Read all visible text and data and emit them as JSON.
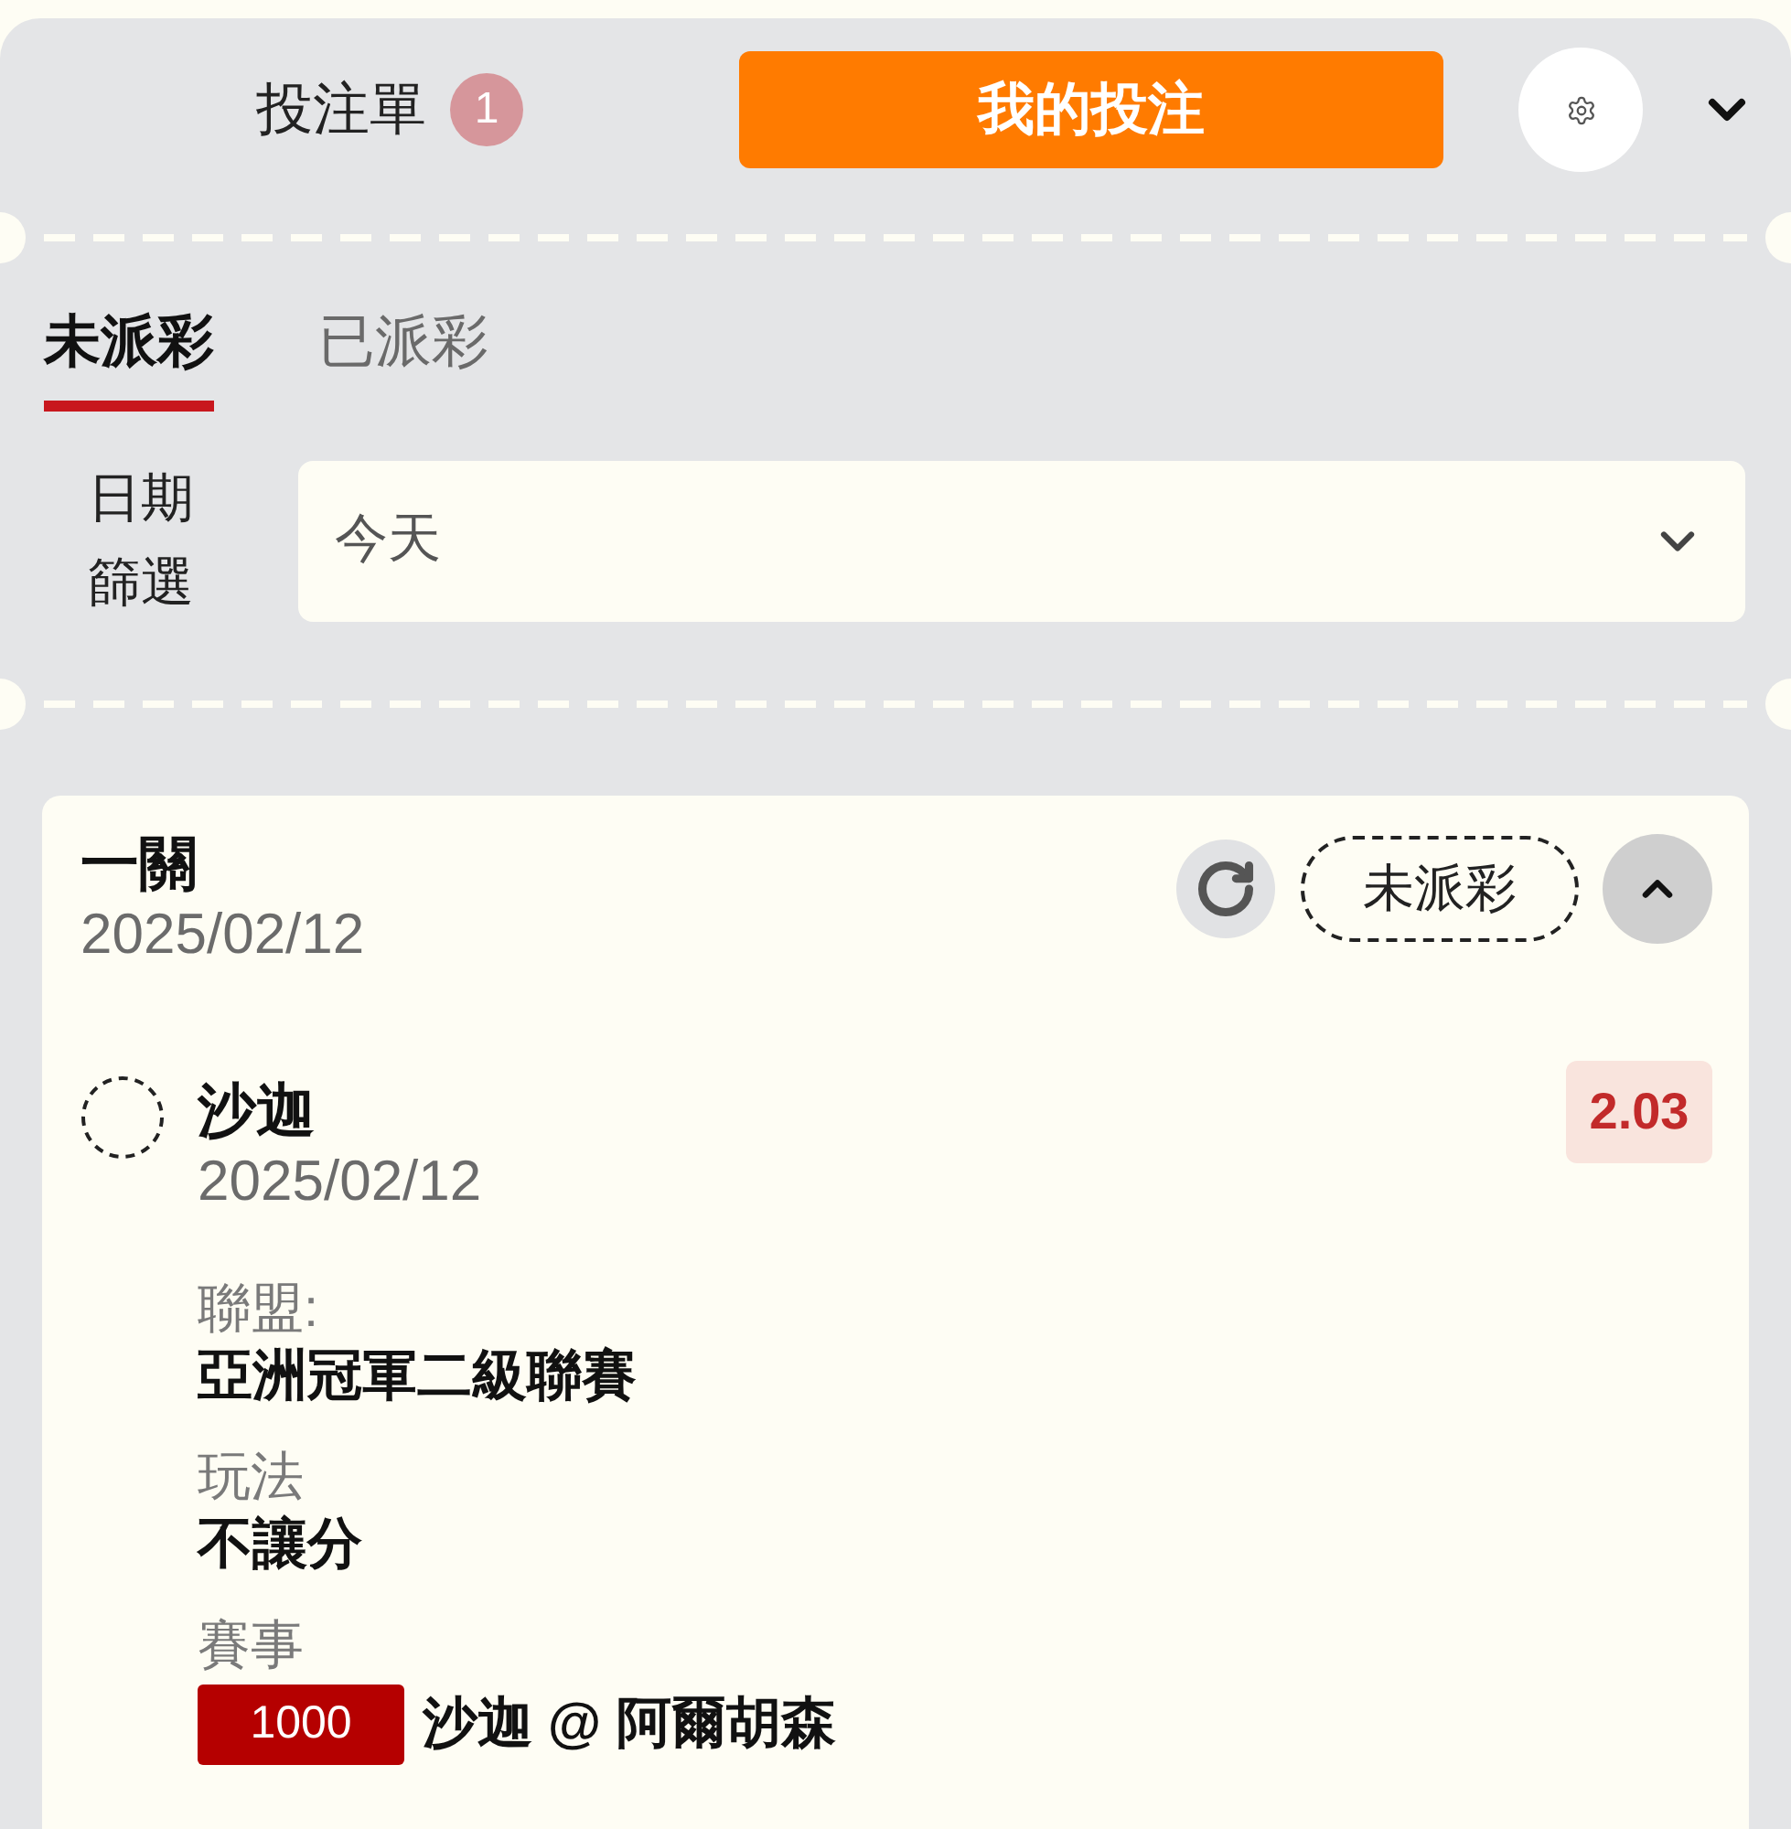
{
  "header": {
    "title": "投注單",
    "count": "1",
    "my_bets_button": "我的投注"
  },
  "tabs": [
    {
      "label": "未派彩",
      "selected": true
    },
    {
      "label": "已派彩",
      "selected": false
    }
  ],
  "date_filter": {
    "label": "日期篩選",
    "value": "今天"
  },
  "bet": {
    "type": "一關",
    "date": "2025/02/12",
    "status": "未派彩",
    "expanded": true,
    "legs": [
      {
        "selection": "沙迦",
        "date": "2025/02/12",
        "odds": "2.03",
        "details": [
          {
            "label": "聯盟:",
            "value": "亞洲冠軍二級聯賽"
          },
          {
            "label": "玩法",
            "value": "不讓分"
          },
          {
            "label": "賽事",
            "tag": "1000",
            "value": "沙迦 @ 阿爾胡森"
          }
        ]
      }
    ]
  }
}
